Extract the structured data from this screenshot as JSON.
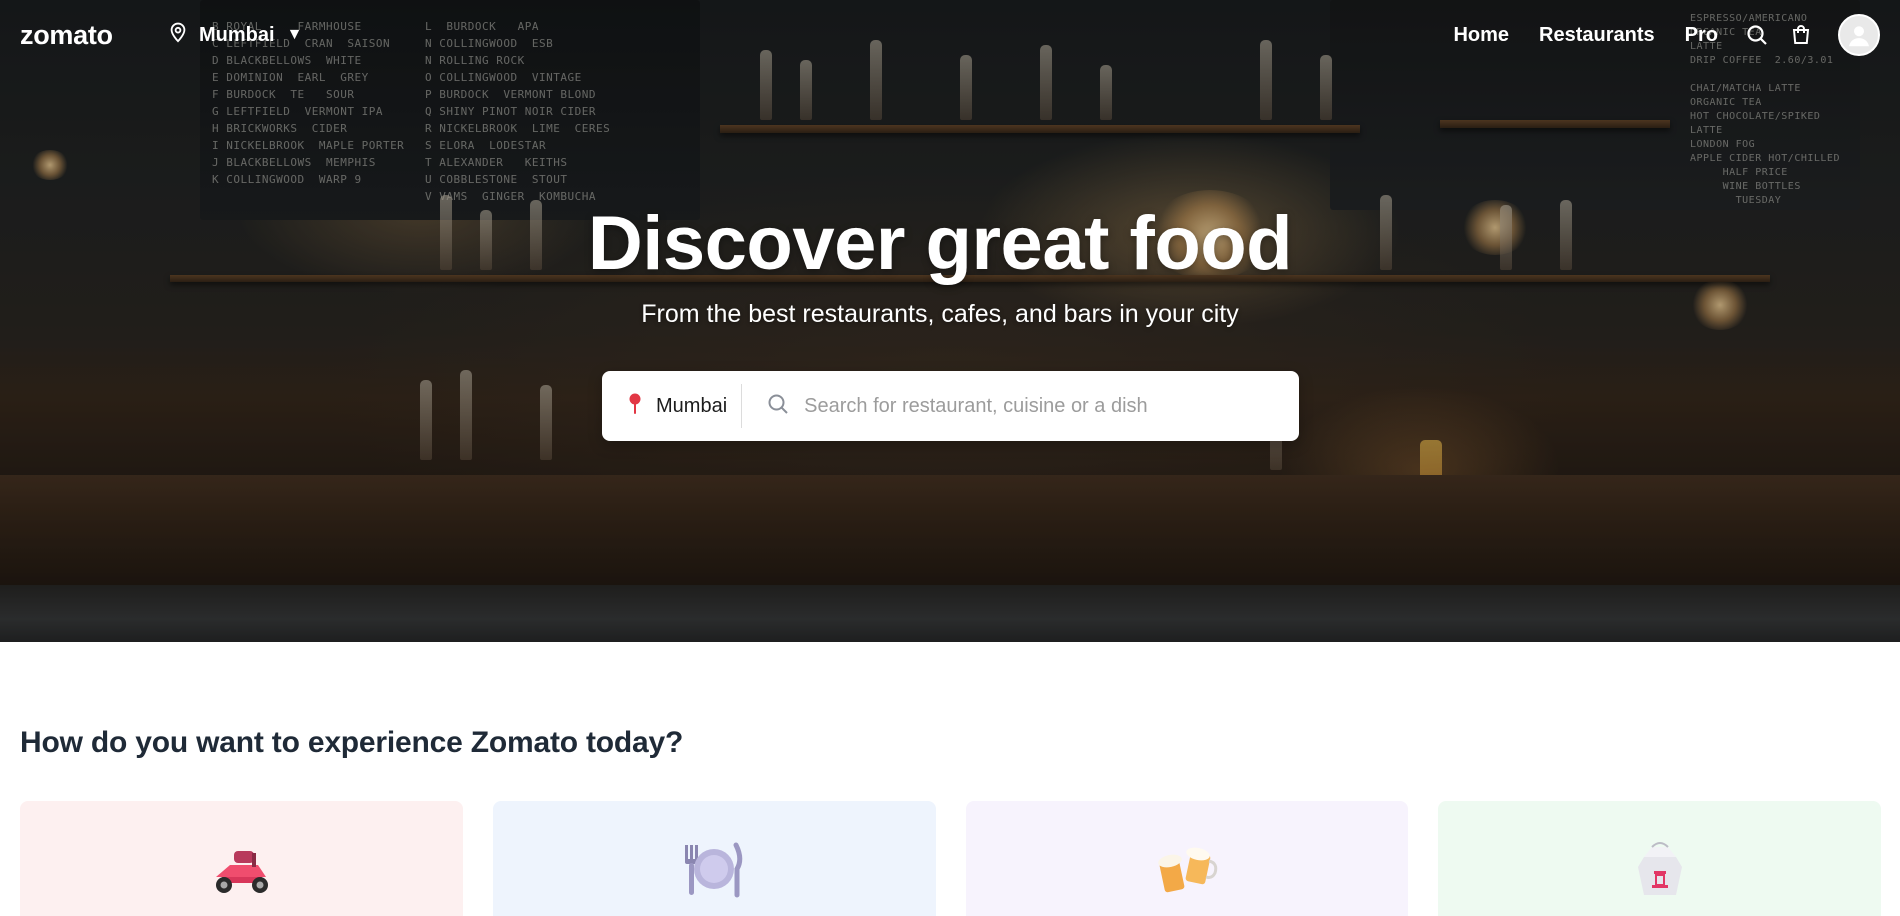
{
  "nav": {
    "logo": "zomato",
    "location": "Mumbai",
    "links": [
      "Home",
      "Restaurants",
      "Pro"
    ],
    "icons": [
      "search-icon",
      "cart-icon",
      "user-avatar"
    ]
  },
  "hero": {
    "title": "Discover great food",
    "subtitle": "From the best restaurants, cafes, and bars in your city",
    "chalkboard_left": "L  BURDOCK   APA\nN COLLINGWOOD  ESB\nN ROLLING ROCK\nO COLLINGWOOD  VINTAGE\nP BURDOCK  VERMONT BLOND\nQ SHINY PINOT NOIR CIDER\nR NICKELBROOK  LIME  CERES\nS ELORA  LODESTAR\nT ALEXANDER   KEITHS\nU COBBLESTONE  STOUT\nV VAMS  GINGER  KOMBUCHA",
    "chalkboard_left2": "B ROYAL     FARMHOUSE\nC LEFTFIELD  CRAN  SAISON\nD BLACKBELLOWS  WHITE\nE DOMINION  EARL  GREY\nF BURDOCK  TE   SOUR\nG LEFTFIELD  VERMONT IPA\nH BRICKWORKS  CIDER\nI NICKELBROOK  MAPLE PORTER\nJ BLACKBELLOWS  MEMPHIS\nK COLLINGWOOD  WARP 9",
    "chalkboard_right": "ESPRESSO/AMERICANO\nORGANIC TEA\nLATTE\nDRIP COFFEE  2.60/3.01\n\nCHAI/MATCHA LATTE\nORGANIC TEA\nHOT CHOCOLATE/SPIKED\nLATTE\nLONDON FOG\nAPPLE CIDER HOT/CHILLED\n     HALF PRICE\n     WINE BOTTLES\n       TUESDAY"
  },
  "search": {
    "location": "Mumbai",
    "placeholder": "Search for restaurant, cuisine or a dish",
    "value": ""
  },
  "experience": {
    "title": "How do you want to experience Zomato today?",
    "cards": [
      {
        "icon": "scooter-icon",
        "bg": "#fdf0f0"
      },
      {
        "icon": "plate-cutlery-icon",
        "bg": "#eef4fd"
      },
      {
        "icon": "beer-mugs-icon",
        "bg": "#f7f3fd"
      },
      {
        "icon": "takeout-box-icon",
        "bg": "#eefaf1"
      }
    ]
  },
  "colors": {
    "brand_red": "#e23744",
    "heading": "#1f2a37"
  }
}
